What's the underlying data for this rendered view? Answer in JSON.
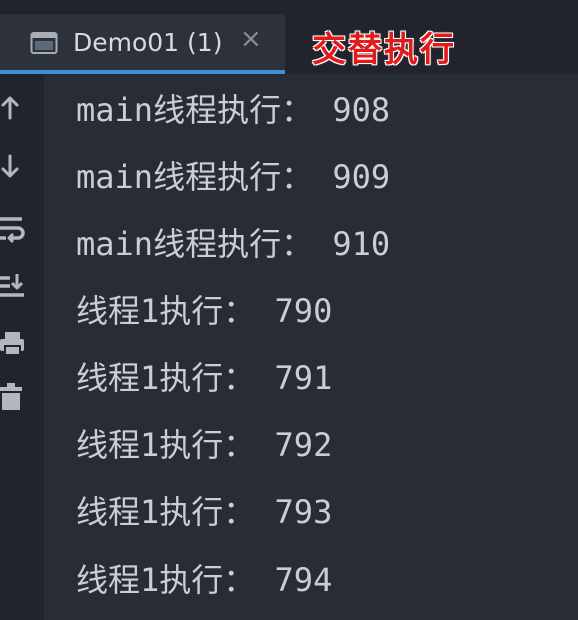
{
  "tab": {
    "title": "Demo01 (1)",
    "close_glyph": "×",
    "icon": "console-window-icon",
    "active": true
  },
  "annotation": "交替执行",
  "toolbar": [
    {
      "name": "scroll-up-icon"
    },
    {
      "name": "scroll-down-icon"
    },
    {
      "name": "soft-wrap-icon"
    },
    {
      "name": "scroll-to-end-icon"
    },
    {
      "name": "print-icon"
    },
    {
      "name": "clear-all-icon"
    }
  ],
  "console": {
    "lines": [
      "main线程执行： 908",
      "main线程执行： 909",
      "main线程执行： 910",
      "线程1执行： 790",
      "线程1执行： 791",
      "线程1执行： 792",
      "线程1执行： 793",
      "线程1执行： 794"
    ]
  },
  "colors": {
    "background": "#282c34",
    "gutter": "#21252b",
    "tab_underline": "#3d8fd6",
    "text": "#c9ced6",
    "annotation": "#e11b1b"
  }
}
